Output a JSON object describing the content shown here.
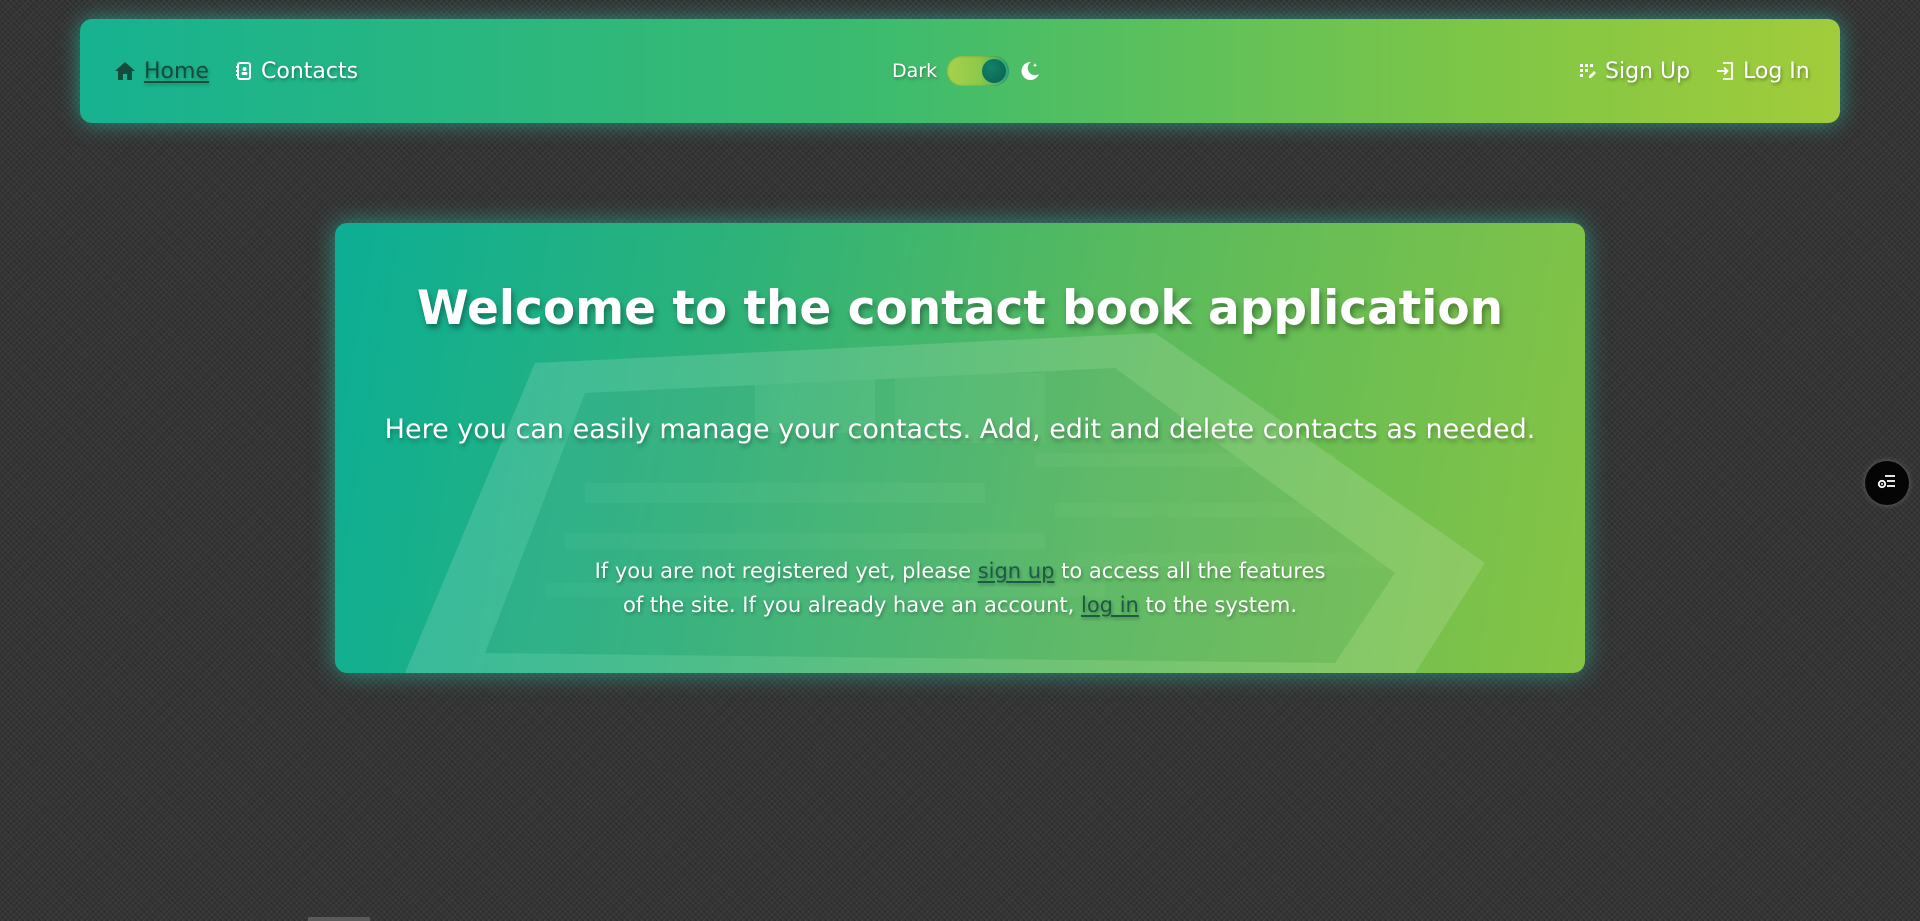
{
  "navbar": {
    "home_label": "Home",
    "contacts_label": "Contacts",
    "theme_label": "Dark",
    "signup_label": "Sign Up",
    "login_label": "Log In"
  },
  "hero": {
    "title": "Welcome to the contact book application",
    "subtitle": "Here you can easily manage your contacts. Add, edit and delete contacts as needed.",
    "info_part1": "If you are not registered yet, please ",
    "signup_link": "sign up",
    "info_part2": " to access all the features of the site. If you already have an account, ",
    "login_link": "log in",
    "info_part3": " to the system."
  },
  "theme": {
    "mode": "dark",
    "toggle_on": true
  },
  "colors": {
    "page_background": "#353535",
    "gradient_start": "#0cae95",
    "gradient_end": "#a2cc3b",
    "active_link": "#134b3d",
    "glow": "#28dcbe"
  },
  "icons": {
    "home": "home-icon",
    "contacts": "address-book-icon",
    "theme": "moon-icon",
    "signup": "signup-icon",
    "login": "login-icon",
    "fab": "settings-list-icon"
  }
}
